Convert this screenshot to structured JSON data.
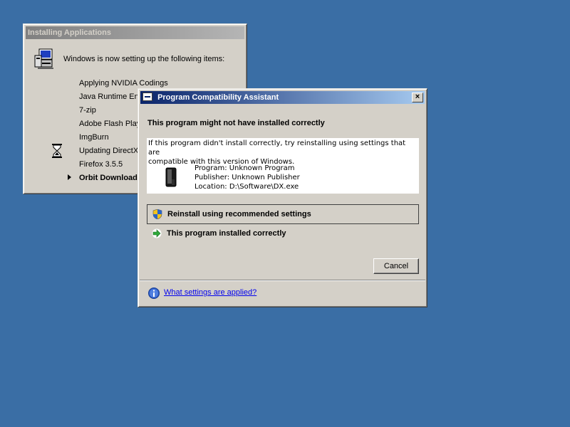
{
  "install_window": {
    "title": "Installing Applications",
    "header": "Windows is now setting up the following items:",
    "items": [
      {
        "label": "Applying NVIDIA Codings"
      },
      {
        "label": "Java Runtime Env"
      },
      {
        "label": "7-zip"
      },
      {
        "label": "Adobe Flash Play"
      },
      {
        "label": "ImgBurn"
      },
      {
        "label": "Updating DirectX"
      },
      {
        "label": "Firefox 3.5.5"
      },
      {
        "label": "Orbit Download"
      }
    ],
    "icons": {
      "app": "computer-setup-icon",
      "busy": "hourglass-icon",
      "current": "arrow-right-icon"
    }
  },
  "pca_dialog": {
    "title": "Program Compatibility Assistant",
    "close_label": "×",
    "heading": "This program might not have installed correctly",
    "info_line1": "If this program didn't install correctly, try reinstalling using settings that are",
    "info_line2": "compatible with this version of Windows.",
    "program": "Program: Unknown Program",
    "publisher": "Publisher: Unknown Publisher",
    "location": "Location: D:\\Software\\DX.exe",
    "option_reinstall": "Reinstall using recommended settings",
    "option_installed": "This program installed correctly",
    "cancel_label": "Cancel",
    "help_link": "What settings are applied?",
    "icons": {
      "program": "program-icon",
      "shield": "shield-icon",
      "arrow": "green-arrow-icon",
      "info": "info-icon"
    }
  },
  "colors": {
    "desktop": "#3a6ea5",
    "active_title": "#0a246a",
    "inactive_title": "#808080",
    "window_face": "#d4d0c8",
    "link": "#0000ee"
  }
}
